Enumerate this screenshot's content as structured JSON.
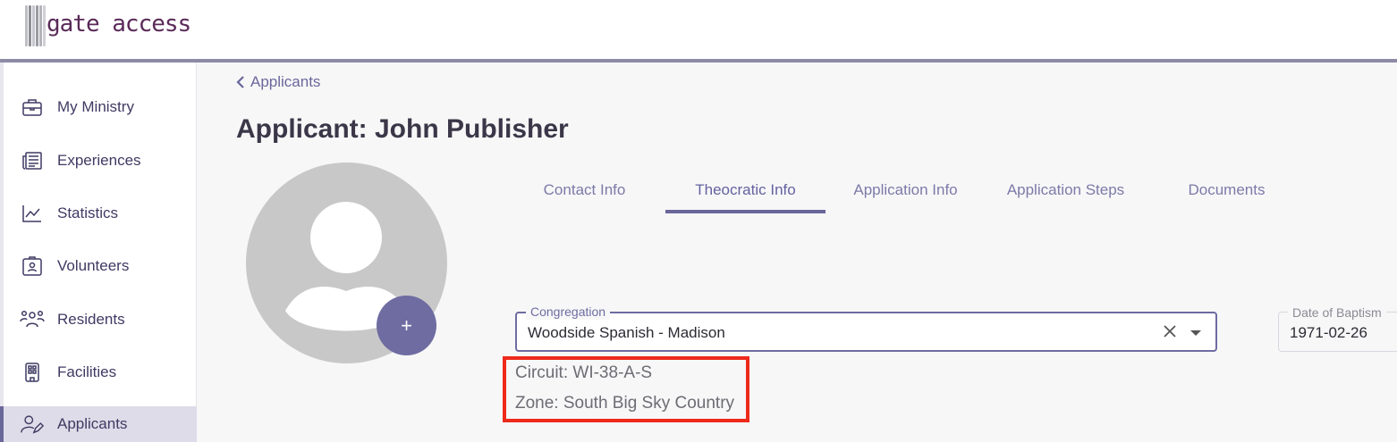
{
  "app": {
    "logo_text": "gate access",
    "brand_color": "#5a2a59",
    "accent": "#6a679b"
  },
  "sidebar": {
    "items": [
      {
        "label": "My Ministry",
        "icon": "briefcase-icon"
      },
      {
        "label": "Experiences",
        "icon": "newspaper-icon"
      },
      {
        "label": "Statistics",
        "icon": "chart-line-icon"
      },
      {
        "label": "Volunteers",
        "icon": "id-badge-icon"
      },
      {
        "label": "Residents",
        "icon": "people-group-icon"
      },
      {
        "label": "Facilities",
        "icon": "building-icon"
      },
      {
        "label": "Applicants",
        "icon": "user-edit-icon",
        "active": true
      }
    ]
  },
  "main": {
    "breadcrumb": "Applicants",
    "title": "Applicant: John Publisher",
    "avatar_add": "+",
    "tabs": [
      {
        "label": "Contact Info"
      },
      {
        "label": "Theocratic Info",
        "active": true
      },
      {
        "label": "Application Info"
      },
      {
        "label": "Application Steps"
      },
      {
        "label": "Documents"
      }
    ],
    "congregation": {
      "label": "Congregation",
      "value": "Woodside Spanish - Madison"
    },
    "baptism": {
      "label": "Date of Baptism",
      "value": "1971-02-26"
    },
    "circuit": "Circuit: WI-38-A-S",
    "zone": "Zone: South Big Sky Country"
  }
}
